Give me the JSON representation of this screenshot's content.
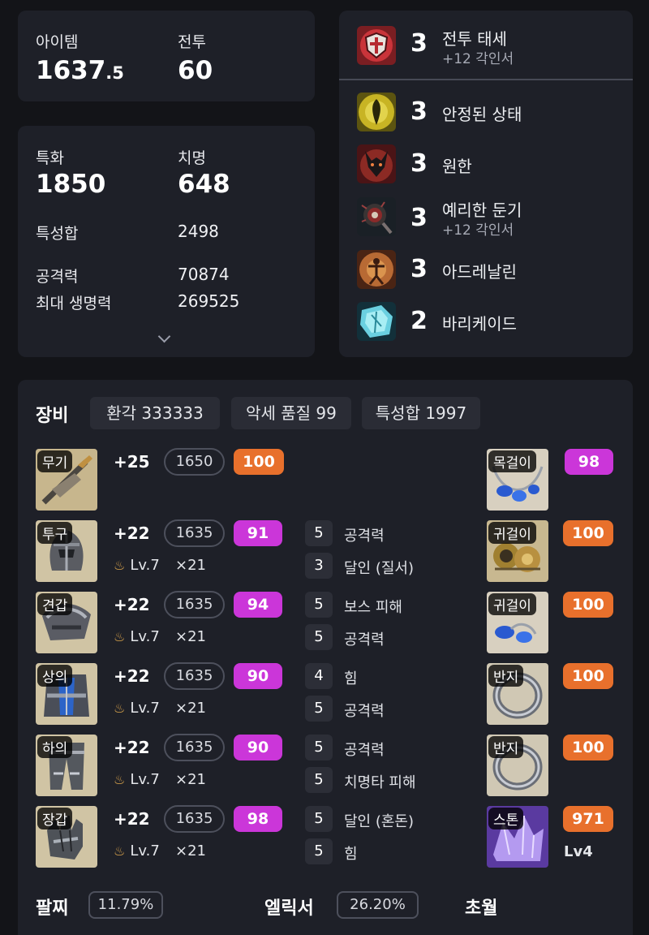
{
  "stats_top": {
    "item_label": "아이템",
    "item_value_main": "1637",
    "item_value_frac": ".5",
    "combat_label": "전투",
    "combat_value": "60"
  },
  "stats_main": {
    "spec_label": "특화",
    "spec_value": "1850",
    "crit_label": "치명",
    "crit_value": "648",
    "sum_label": "특성합",
    "sum_value": "2498",
    "atk_label": "공격력",
    "atk_value": "70874",
    "hp_label": "최대 생명력",
    "hp_value": "269525"
  },
  "engravings": [
    {
      "level": "3",
      "name": "전투 태세",
      "sub": "+12 각인서",
      "icon": "shield-engraving-icon"
    },
    {
      "level": "3",
      "name": "안정된 상태",
      "sub": "",
      "icon": "stable-engraving-icon"
    },
    {
      "level": "3",
      "name": "원한",
      "sub": "",
      "icon": "grudge-engraving-icon"
    },
    {
      "level": "3",
      "name": "예리한 둔기",
      "sub": "+12 각인서",
      "icon": "keen-blunt-engraving-icon"
    },
    {
      "level": "3",
      "name": "아드레날린",
      "sub": "",
      "icon": "adrenaline-engraving-icon"
    },
    {
      "level": "2",
      "name": "바리케이드",
      "sub": "",
      "icon": "barricade-engraving-icon"
    }
  ],
  "equipment": {
    "title": "장비",
    "chips": [
      "환각 333333",
      "악세 품질 99",
      "특성합 1997"
    ],
    "gear": [
      {
        "slot": "무기",
        "plus": "+25",
        "ilvl": "1650",
        "quality": "100",
        "qcolor": "orange",
        "lv": "",
        "mult": "",
        "effects": []
      },
      {
        "slot": "투구",
        "plus": "+22",
        "ilvl": "1635",
        "quality": "91",
        "qcolor": "purple",
        "lv": "Lv.7",
        "mult": "×21",
        "effects": [
          {
            "n": "5",
            "t": "공격력"
          },
          {
            "n": "3",
            "t": "달인 (질서)"
          }
        ]
      },
      {
        "slot": "견갑",
        "plus": "+22",
        "ilvl": "1635",
        "quality": "94",
        "qcolor": "purple",
        "lv": "Lv.7",
        "mult": "×21",
        "effects": [
          {
            "n": "5",
            "t": "보스 피해"
          },
          {
            "n": "5",
            "t": "공격력"
          }
        ]
      },
      {
        "slot": "상의",
        "plus": "+22",
        "ilvl": "1635",
        "quality": "90",
        "qcolor": "purple",
        "lv": "Lv.7",
        "mult": "×21",
        "effects": [
          {
            "n": "4",
            "t": "힘"
          },
          {
            "n": "5",
            "t": "공격력"
          }
        ]
      },
      {
        "slot": "하의",
        "plus": "+22",
        "ilvl": "1635",
        "quality": "90",
        "qcolor": "purple",
        "lv": "Lv.7",
        "mult": "×21",
        "effects": [
          {
            "n": "5",
            "t": "공격력"
          },
          {
            "n": "5",
            "t": "치명타 피해"
          }
        ]
      },
      {
        "slot": "장갑",
        "plus": "+22",
        "ilvl": "1635",
        "quality": "98",
        "qcolor": "purple",
        "lv": "Lv.7",
        "mult": "×21",
        "effects": [
          {
            "n": "5",
            "t": "달인 (혼돈)"
          },
          {
            "n": "5",
            "t": "힘"
          }
        ]
      }
    ],
    "accessories": [
      {
        "slot": "목걸이",
        "quality": "98",
        "qcolor": "purple"
      },
      {
        "slot": "귀걸이",
        "quality": "100",
        "qcolor": "orange"
      },
      {
        "slot": "귀걸이",
        "quality": "100",
        "qcolor": "orange"
      },
      {
        "slot": "반지",
        "quality": "100",
        "qcolor": "orange"
      },
      {
        "slot": "반지",
        "quality": "100",
        "qcolor": "orange"
      },
      {
        "slot": "스톤",
        "quality": "971",
        "qcolor": "orange",
        "extra": "Lv4"
      }
    ]
  },
  "footer": {
    "bracelet_label": "팔찌",
    "bracelet_value": "11.79%",
    "elixir_label": "엘릭서",
    "elixir_value": "26.20%",
    "transcend_label": "초월"
  },
  "colors": {
    "purple": "#cb36d9",
    "orange": "#e8702c",
    "card": "#1e2028",
    "bg": "#131418"
  }
}
